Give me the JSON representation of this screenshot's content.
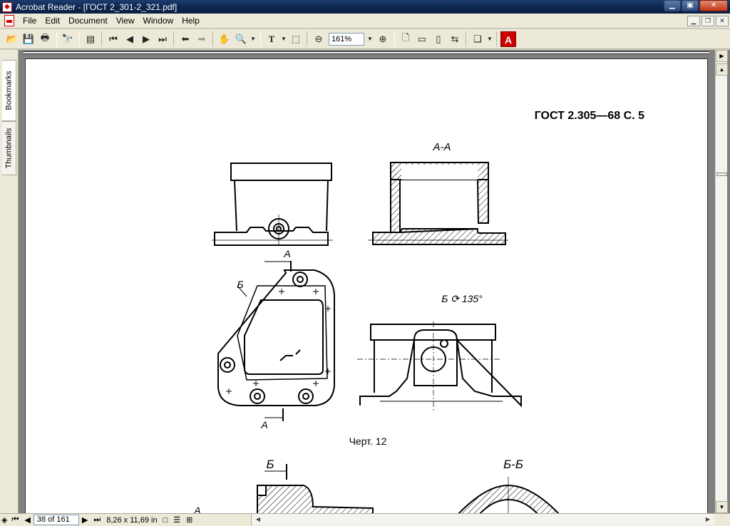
{
  "window": {
    "title": "Acrobat Reader - [ГОСТ 2_301-2_321.pdf]",
    "min": "▁",
    "max": "▣",
    "close": "✕"
  },
  "menu": [
    {
      "label": "File"
    },
    {
      "label": "Edit"
    },
    {
      "label": "Document"
    },
    {
      "label": "View"
    },
    {
      "label": "Window"
    },
    {
      "label": "Help"
    }
  ],
  "toolbar": {
    "zoom": "161%"
  },
  "sidebar": {
    "tabs": [
      {
        "label": "Bookmarks"
      },
      {
        "label": "Thumbnails"
      }
    ]
  },
  "page": {
    "header": "ГОСТ 2.305—68 С. 5",
    "section_aa": "А-А",
    "label_a_top": "А",
    "label_a_bottom": "А",
    "label_b": "Б",
    "view_b": "Б ⟳ 135°",
    "caption": "Черт. 12",
    "label_b2": "Б",
    "section_bb": "Б-Б",
    "label_a_small": "А"
  },
  "status": {
    "page": "38 of 161",
    "size": "8,26 x 11,69 in"
  }
}
